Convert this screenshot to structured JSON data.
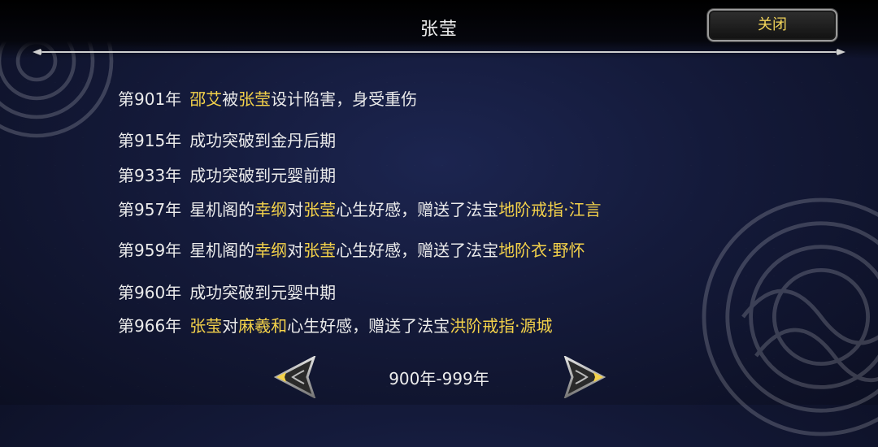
{
  "header": {
    "title": "张莹",
    "close_label": "关闭"
  },
  "log": [
    {
      "year": "第901年",
      "segments": [
        {
          "t": "邵艾",
          "hl": true
        },
        {
          "t": "被",
          "hl": false
        },
        {
          "t": "张莹",
          "hl": true
        },
        {
          "t": "设计陷害，身受重伤",
          "hl": false
        }
      ]
    },
    {
      "year": "第915年",
      "segments": [
        {
          "t": "成功突破到金丹后期",
          "hl": false
        }
      ]
    },
    {
      "year": "第933年",
      "segments": [
        {
          "t": "成功突破到元婴前期",
          "hl": false
        }
      ]
    },
    {
      "year": "第957年",
      "segments": [
        {
          "t": "星机阁的",
          "hl": false
        },
        {
          "t": "幸纲",
          "hl": true
        },
        {
          "t": "对",
          "hl": false
        },
        {
          "t": "张莹",
          "hl": true
        },
        {
          "t": "心生好感，赠送了法宝",
          "hl": false
        },
        {
          "t": "地阶戒指·江言",
          "hl": true
        }
      ]
    },
    {
      "year": "第959年",
      "segments": [
        {
          "t": "星机阁的",
          "hl": false
        },
        {
          "t": "幸纲",
          "hl": true
        },
        {
          "t": "对",
          "hl": false
        },
        {
          "t": "张莹",
          "hl": true
        },
        {
          "t": "心生好感，赠送了法宝",
          "hl": false
        },
        {
          "t": "地阶衣·野怀",
          "hl": true
        }
      ]
    },
    {
      "year": "第960年",
      "segments": [
        {
          "t": "成功突破到元婴中期",
          "hl": false
        }
      ]
    },
    {
      "year": "第966年",
      "segments": [
        {
          "t": "张莹",
          "hl": true
        },
        {
          "t": "对",
          "hl": false
        },
        {
          "t": "麻羲和",
          "hl": true
        },
        {
          "t": "心生好感，赠送了法宝",
          "hl": false
        },
        {
          "t": "洪阶戒指·源城",
          "hl": true
        }
      ]
    }
  ],
  "pager": {
    "range_label": "900年-999年",
    "prev_icon": "left-arrow-icon",
    "next_icon": "right-arrow-icon"
  },
  "colors": {
    "highlight": "#f4d24a",
    "text": "#ebebeb",
    "background": "#141a3a"
  }
}
